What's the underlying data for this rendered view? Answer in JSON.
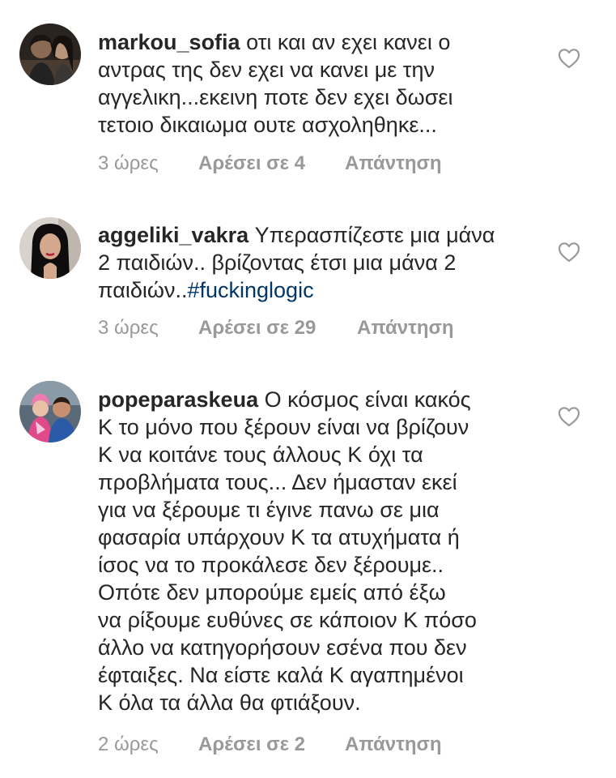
{
  "comments": [
    {
      "username": "markou_sofia",
      "text": "οτι και αν εχει κανει ο\nαντρας της δεν εχει να κανει με την\nαγγελικη...εκεινη ποτε δεν εχει δωσει\nτετοιο δικαιωμα ουτε ασχοληθηκε...",
      "time": "3 ώρες",
      "likes": "Αρέσει σε 4",
      "reply": "Απάντηση",
      "icon": "heart-outline-icon"
    },
    {
      "username": "aggeliki_vakra",
      "text": "Υπερασπίζεστε μια μάνα\n2 παιδιών.. βρίζοντας έτσι μια μάνα 2\nπαιδιών..",
      "hashtag": "#fuckinglogic",
      "time": "3 ώρες",
      "likes": "Αρέσει σε 29",
      "reply": "Απάντηση",
      "icon": "heart-outline-icon"
    },
    {
      "username": "popeparaskeua",
      "text": "Ο κόσμος είναι κακός\nΚ το μόνο που ξέρουν είναι να βρίζουν\nΚ να κοιτάνε τους άλλους Κ όχι τα\nπροβλήματα τους... Δεν ήμασταν εκεί\nγια να ξέρουμε τι έγινε πανω σε μια\nφασαρία υπάρχουν Κ τα ατυχήματα ή\nίσος να το προκάλεσε  δεν ξέρουμε..\nΟπότε δεν μπορούμε εμείς από έξω\nνα ρίξουμε ευθύνες σε κάποιον Κ πόσο\nάλλο να κατηγορήσουν εσένα που δεν\nέφταιξες. Να είστε καλά Κ αγαπημένοι\nΚ όλα τα άλλα θα φτιάξουν.",
      "time": "2 ώρες",
      "likes": "Αρέσει σε 2",
      "reply": "Απάντηση",
      "icon": "heart-outline-icon"
    }
  ],
  "colors": {
    "text": "#262626",
    "meta": "#999999",
    "hashtag": "#003569"
  }
}
